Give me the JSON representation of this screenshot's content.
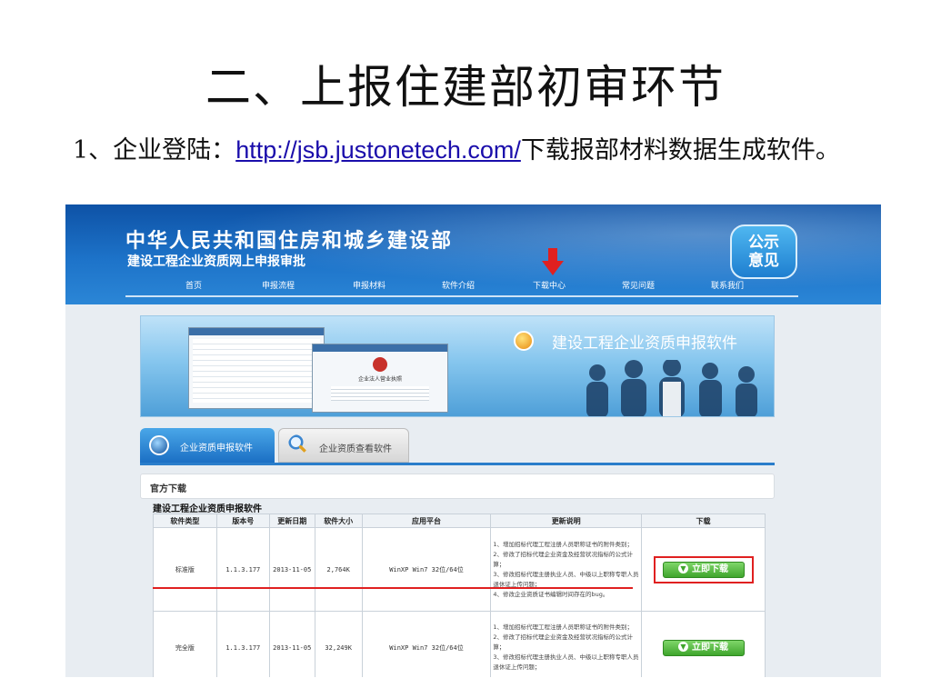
{
  "slide": {
    "title": "二、上报住建部初审环节",
    "step_prefix": "1、企业登陆：",
    "step_link": "http://jsb.justonetech.com/",
    "step_suffix": "下载报部材料数据生成软件。"
  },
  "site": {
    "ministry_name": "中华人民共和国住房和城乡建设部",
    "subtitle": "建设工程企业资质网上申报审批",
    "notice_badge": [
      "公示",
      "意见"
    ],
    "nav": [
      "首页",
      "申报流程",
      "申报材料",
      "软件介绍",
      "下载中心",
      "常见问题",
      "联系我们"
    ],
    "nav_marked": "下载中心",
    "banner_title": "建设工程企业资质申报软件",
    "banner_window_title": "企业法人营业执照",
    "tabs": [
      "企业资质申报软件",
      "企业资质查看软件"
    ],
    "active_tab": "企业资质申报软件",
    "panel_title": "官方下载",
    "section_title": "建设工程企业资质申报软件",
    "table": {
      "headers": [
        "软件类型",
        "版本号",
        "更新日期",
        "软件大小",
        "应用平台",
        "更新说明",
        "下载"
      ],
      "rows": [
        {
          "type": "标准版",
          "version": "1.1.3.177",
          "date": "2013-11-05",
          "size": "2,764K",
          "platform": "WinXP Win7 32位/64位",
          "notes": [
            "1、增加招标代理工程注册人员职称证书的附件类别；",
            "2、修改了招标代理企业资金及经营状况指标的公式计算；",
            "3、修改招标代理主册执业人员、中级以上职称专职人员退休证上传问题；",
            "4、修改企业资质证书编辑时间存在的bug。"
          ],
          "download": "立即下载"
        },
        {
          "type": "完全版",
          "version": "1.1.3.177",
          "date": "2013-11-05",
          "size": "32,249K",
          "platform": "WinXP Win7 32位/64位",
          "notes": [
            "1、增加招标代理工程注册人员职称证书的附件类别；",
            "2、修改了招标代理企业资金及经营状况指标的公式计算；",
            "3、修改招标代理主册执业人员、中级以上职称专职人员退休证上传问题；"
          ],
          "download": "立即下载"
        }
      ]
    }
  },
  "colors": {
    "header_blue": "#1d73c9",
    "annotation_red": "#e02020",
    "download_green": "#3fa52c"
  }
}
